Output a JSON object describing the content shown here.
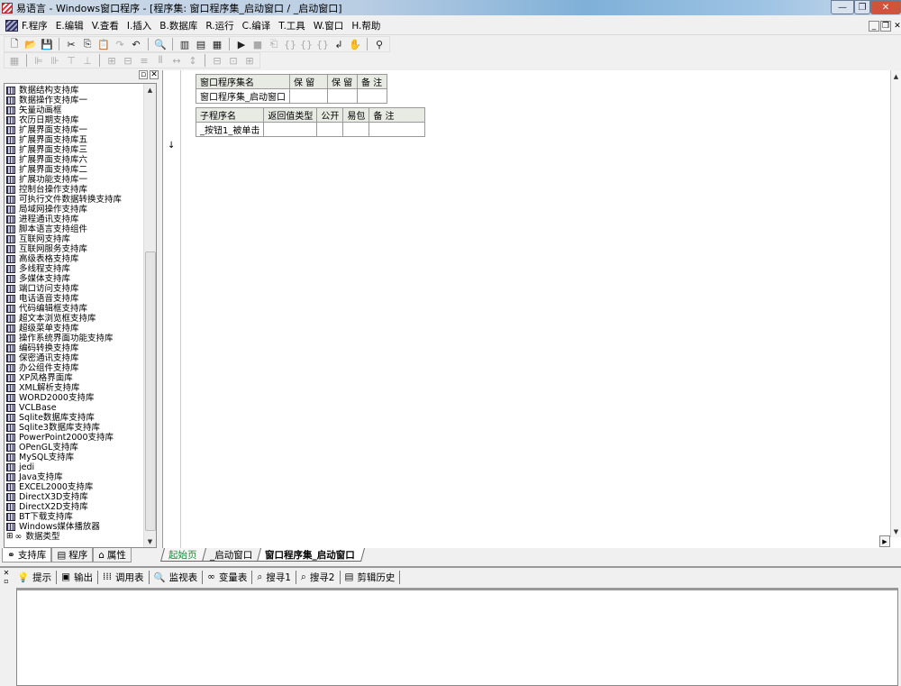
{
  "window": {
    "title": "易语言 - Windows窗口程序 - [程序集: 窗口程序集_启动窗口 / _启动窗口]"
  },
  "menu": [
    "F.程序",
    "E.编辑",
    "V.查看",
    "I.插入",
    "B.数据库",
    "R.运行",
    "C.编译",
    "T.工具",
    "W.窗口",
    "H.帮助"
  ],
  "left_panel": {
    "libraries": [
      "数据结构支持库",
      "数据操作支持库一",
      "矢量动画框",
      "农历日期支持库",
      "扩展界面支持库一",
      "扩展界面支持库五",
      "扩展界面支持库三",
      "扩展界面支持库六",
      "扩展界面支持库二",
      "扩展功能支持库一",
      "控制台操作支持库",
      "可执行文件数据转换支持库",
      "局域网操作支持库",
      "进程通讯支持库",
      "脚本语言支持组件",
      "互联网支持库",
      "互联网服务支持库",
      "高级表格支持库",
      "多线程支持库",
      "多媒体支持库",
      "端口访问支持库",
      "电话语音支持库",
      "代码编辑框支持库",
      "超文本浏览框支持库",
      "超级菜单支持库",
      "操作系统界面功能支持库",
      "编码转换支持库",
      "保密通讯支持库",
      "办公组件支持库",
      "XP风格界面库",
      "XML解析支持库",
      "WORD2000支持库",
      "VCLBase",
      "Sqlite数据库支持库",
      "Sqlite3数据库支持库",
      "PowerPoint2000支持库",
      "OPenGL支持库",
      "MySQL支持库",
      "jedi",
      "Java支持库",
      "EXCEL2000支持库",
      "DirectX3D支持库",
      "DirectX2D支持库",
      "BT下载支持库",
      "Windows媒体播放器"
    ],
    "datatype_node": "数据类型",
    "tabs": [
      "支持库",
      "程序",
      "属性"
    ]
  },
  "editor": {
    "assembly_table": {
      "headers": [
        "窗口程序集名",
        "保 留",
        "保 留",
        "备 注"
      ],
      "row": [
        "窗口程序集_启动窗口",
        "",
        "",
        ""
      ]
    },
    "sub_table": {
      "headers": [
        "子程序名",
        "返回值类型",
        "公开",
        "易包",
        "备 注"
      ],
      "row": [
        "_按钮1_被单击",
        "",
        "",
        "",
        ""
      ]
    },
    "tabs": [
      "起始页",
      "_启动窗口",
      "窗口程序集_启动窗口"
    ]
  },
  "bottom_tabs": [
    "提示",
    "输出",
    "调用表",
    "监视表",
    "变量表",
    "搜寻1",
    "搜寻2",
    "剪辑历史"
  ]
}
